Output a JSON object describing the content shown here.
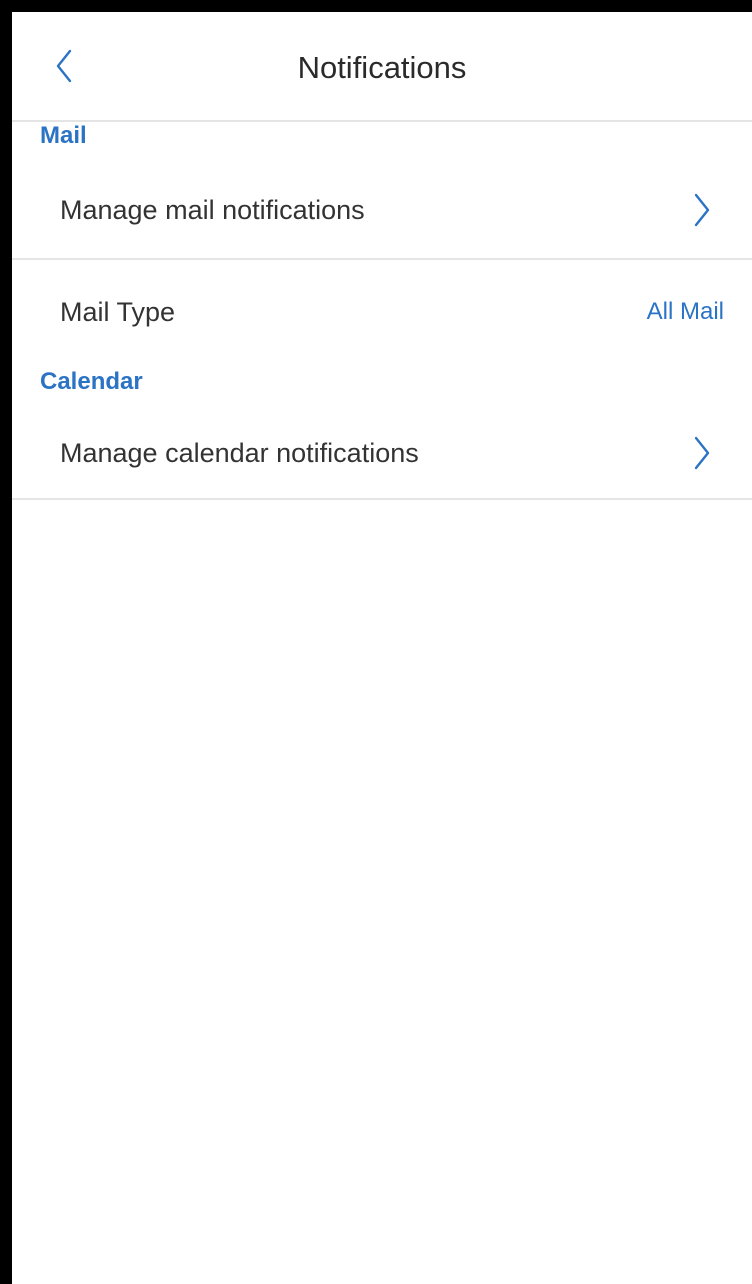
{
  "header": {
    "back_icon": "chevron-left-icon",
    "title": "Notifications"
  },
  "mail_section": {
    "label": "Mail",
    "manage_row": {
      "label": "Manage mail notifications",
      "icon": "chevron-right-icon"
    },
    "type_row": {
      "label": "Mail Type",
      "value": "All Mail"
    }
  },
  "calendar_section": {
    "label": "Calendar",
    "manage_row": {
      "label": "Manage calendar notifications",
      "icon": "chevron-right-icon"
    }
  },
  "colors": {
    "accent": "#2b73c4",
    "text": "#333333",
    "divider": "#e6e6e6",
    "background": "#ffffff",
    "frame": "#000000"
  }
}
